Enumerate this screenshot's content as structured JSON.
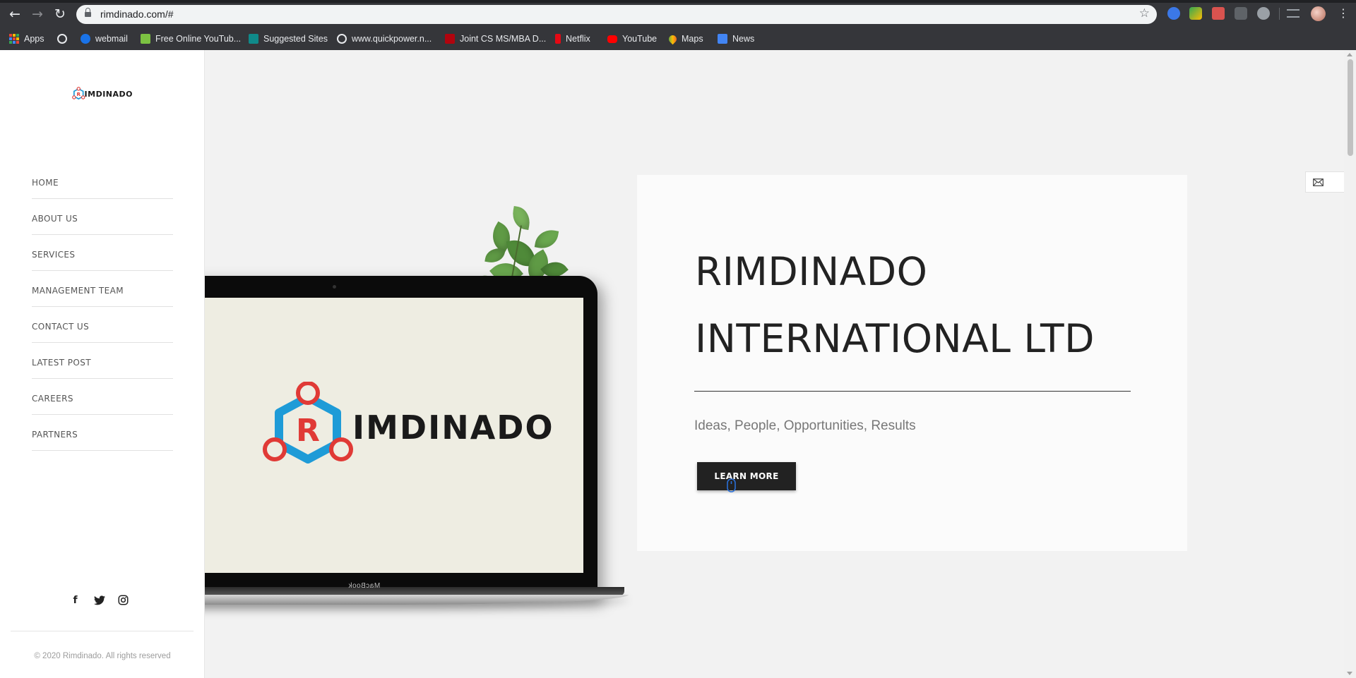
{
  "browser": {
    "url": "rimdinado.com/#",
    "bookmarks": [
      {
        "label": "Apps",
        "icon": "apps-grid-icon"
      },
      {
        "label": "",
        "icon": "globe-icon"
      },
      {
        "label": "webmail",
        "icon": "webmail-icon"
      },
      {
        "label": "Free Online YouTub...",
        "icon": "download-icon"
      },
      {
        "label": "Suggested Sites",
        "icon": "bing-icon"
      },
      {
        "label": "www.quickpower.n...",
        "icon": "globe-icon"
      },
      {
        "label": "Joint CS MS/MBA D...",
        "icon": "stanford-icon"
      },
      {
        "label": "Netflix",
        "icon": "netflix-icon"
      },
      {
        "label": "YouTube",
        "icon": "youtube-icon"
      },
      {
        "label": "Maps",
        "icon": "maps-icon"
      },
      {
        "label": "News",
        "icon": "news-icon"
      }
    ]
  },
  "sidebar": {
    "logo_text": "IMDINADO",
    "logo_letter": "R",
    "menu": [
      {
        "label": "HOME"
      },
      {
        "label": "ABOUT US"
      },
      {
        "label": "SERVICES"
      },
      {
        "label": "MANAGEMENT TEAM"
      },
      {
        "label": "CONTACT US"
      },
      {
        "label": "LATEST POST"
      },
      {
        "label": "CAREERS"
      },
      {
        "label": "PARTNERS"
      }
    ],
    "socials": [
      {
        "icon": "facebook-icon",
        "glyph": "f"
      },
      {
        "icon": "twitter-icon",
        "glyph": ""
      },
      {
        "icon": "instagram-icon",
        "glyph": ""
      }
    ],
    "copyright": "© 2020 Rimdinado. All rights reserved"
  },
  "hero": {
    "screen_logo_letter": "R",
    "screen_logo_text": "IMDINADO",
    "laptop_label": "MacBook",
    "title_line1": "RIMDINADO",
    "title_line2": "INTERNATIONAL LTD",
    "tagline": "Ideas, People, Opportunities, Results",
    "cta_label": "LEARN MORE"
  },
  "colors": {
    "logo_red": "#e03a36",
    "logo_blue": "#1e9bd7",
    "dark": "#222222",
    "page_bg": "#f2f2f2"
  }
}
